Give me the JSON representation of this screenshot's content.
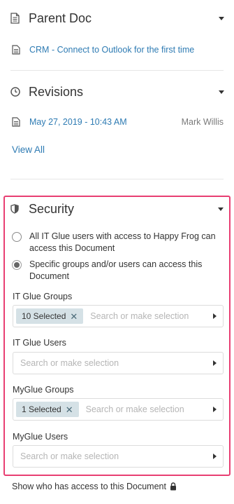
{
  "parent_doc": {
    "title": "Parent Doc",
    "icon": "document-icon",
    "link_text": "CRM - Connect to Outlook for the first time"
  },
  "revisions": {
    "title": "Revisions",
    "icon": "clock-icon",
    "entries": [
      {
        "date": "May 27, 2019 - 10:43 AM",
        "author": "Mark Willis"
      }
    ],
    "view_all": "View All"
  },
  "security": {
    "title": "Security",
    "icon": "shield-icon",
    "options": [
      {
        "label": "All IT Glue users with access to Happy Frog can access this Document",
        "selected": false
      },
      {
        "label": "Specific groups and/or users can access this Document",
        "selected": true
      }
    ],
    "fields": {
      "itglue_groups": {
        "label": "IT Glue Groups",
        "tag": "10 Selected",
        "placeholder": "Search or make selection"
      },
      "itglue_users": {
        "label": "IT Glue Users",
        "placeholder": "Search or make selection"
      },
      "myglue_groups": {
        "label": "MyGlue Groups",
        "tag": "1 Selected",
        "placeholder": "Search or make selection"
      },
      "myglue_users": {
        "label": "MyGlue Users",
        "placeholder": "Search or make selection"
      }
    },
    "highlight_color": "#e83e72"
  },
  "footer": {
    "access_link": "Show who has access to this Document",
    "icon": "lock-icon"
  },
  "colors": {
    "link": "#2e7bb3",
    "text": "#333333",
    "placeholder": "#b5b5b5",
    "tag_bg": "#d5e1e6"
  }
}
